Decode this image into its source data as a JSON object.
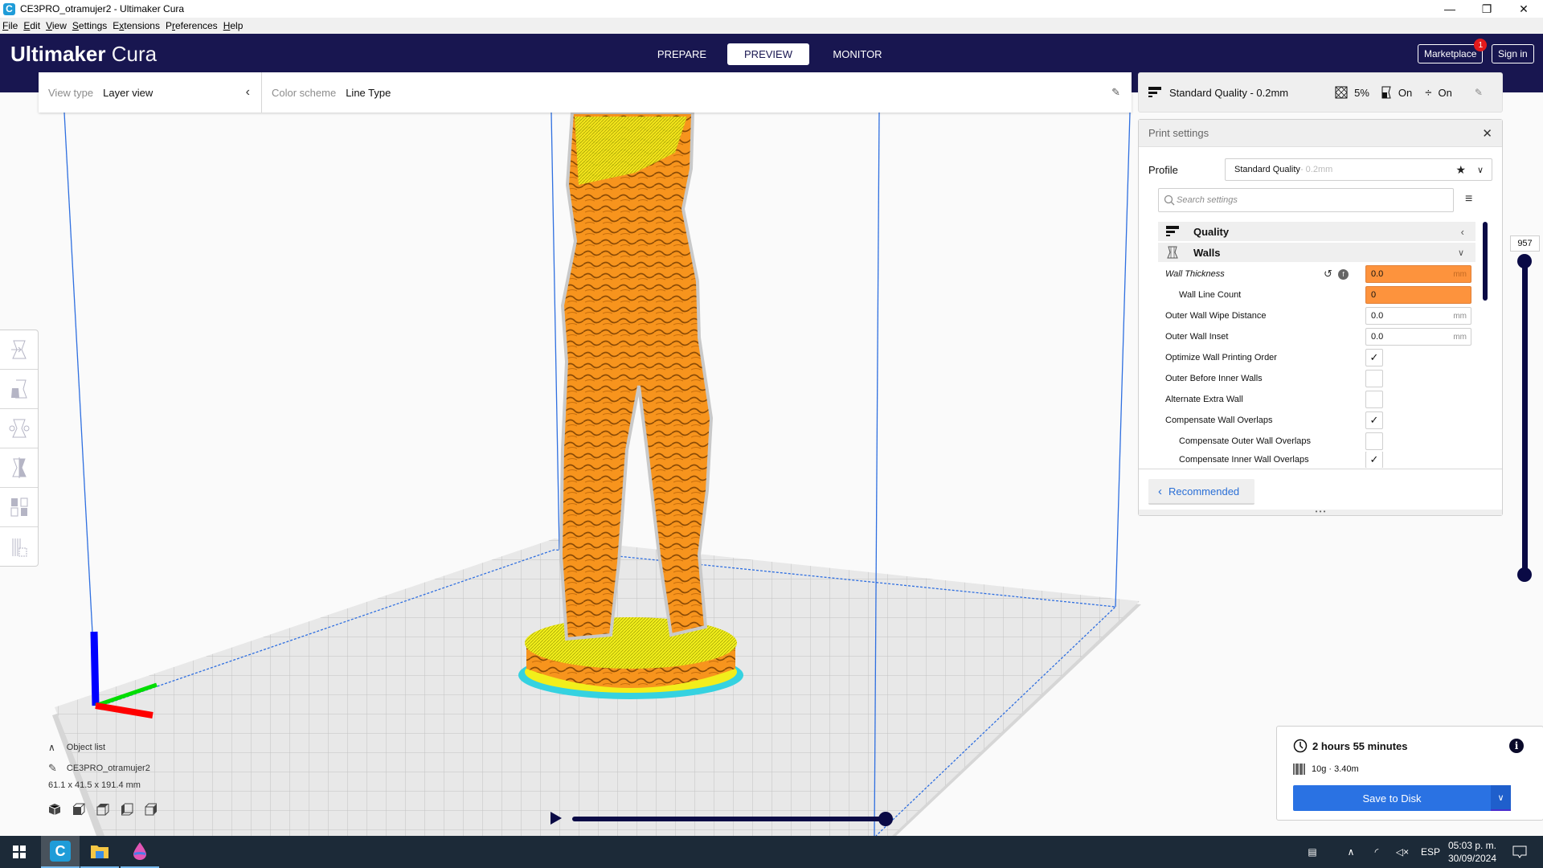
{
  "window": {
    "title": "CE3PRO_otramujer2 - Ultimaker Cura",
    "controls": {
      "minimize": "—",
      "maximize": "❐",
      "close": "✕"
    }
  },
  "menu": [
    {
      "label": "File",
      "accel": "F"
    },
    {
      "label": "Edit",
      "accel": "E"
    },
    {
      "label": "View",
      "accel": "V"
    },
    {
      "label": "Settings",
      "accel": "S"
    },
    {
      "label": "Extensions",
      "accel": "x"
    },
    {
      "label": "Preferences",
      "accel": "r"
    },
    {
      "label": "Help",
      "accel": "H"
    }
  ],
  "header": {
    "logo_bold": "Ultimaker",
    "logo_light": "Cura",
    "stages": [
      {
        "label": "PREPARE",
        "active": false
      },
      {
        "label": "PREVIEW",
        "active": true
      },
      {
        "label": "MONITOR",
        "active": false
      }
    ],
    "marketplace_label": "Marketplace",
    "marketplace_badge": "1",
    "signin_label": "Sign in"
  },
  "viewbar": {
    "view_type_label": "View type",
    "view_type_value": "Layer view",
    "color_scheme_label": "Color scheme",
    "color_scheme_value": "Line Type"
  },
  "setup_summary": {
    "profile": "Standard Quality - 0.2mm",
    "infill": "5%",
    "support": "On",
    "adhesion": "On"
  },
  "print_settings": {
    "title": "Print settings",
    "profile_label": "Profile",
    "profile_name": "Standard Quality",
    "profile_suffix": " - 0.2mm",
    "search_placeholder": "Search settings",
    "categories": [
      {
        "label": "Quality",
        "icon": "quality-icon",
        "expanded": false
      },
      {
        "label": "Walls",
        "icon": "walls-icon",
        "expanded": true
      }
    ],
    "settings": [
      {
        "label": "Wall Thickness",
        "type": "number",
        "value": "0.0",
        "unit": "mm",
        "highlight": true,
        "italic": true,
        "indent": 0
      },
      {
        "label": "Wall Line Count",
        "type": "number",
        "value": "0",
        "unit": "",
        "highlight": true,
        "italic": false,
        "indent": 1
      },
      {
        "label": "Outer Wall Wipe Distance",
        "type": "number",
        "value": "0.0",
        "unit": "mm",
        "highlight": false,
        "indent": 0
      },
      {
        "label": "Outer Wall Inset",
        "type": "number",
        "value": "0.0",
        "unit": "mm",
        "highlight": false,
        "indent": 0
      },
      {
        "label": "Optimize Wall Printing Order",
        "type": "check",
        "checked": true,
        "indent": 0
      },
      {
        "label": "Outer Before Inner Walls",
        "type": "check",
        "checked": false,
        "indent": 0
      },
      {
        "label": "Alternate Extra Wall",
        "type": "check",
        "checked": false,
        "indent": 0
      },
      {
        "label": "Compensate Wall Overlaps",
        "type": "check",
        "checked": true,
        "indent": 0
      },
      {
        "label": "Compensate Outer Wall Overlaps",
        "type": "check",
        "checked": false,
        "indent": 1
      },
      {
        "label": "Compensate Inner Wall Overlaps",
        "type": "check",
        "checked": true,
        "indent": 1
      }
    ],
    "recommended_label": "Recommended"
  },
  "layer_slider": {
    "current_layer": "957"
  },
  "object": {
    "list_label": "Object list",
    "name": "CE3PRO_otramujer2",
    "dimensions": "61.1 x 41.5 x 191.4 mm"
  },
  "output": {
    "print_time": "2 hours 55 minutes",
    "material": "10g · 3.40m",
    "save_label": "Save to Disk"
  },
  "taskbar": {
    "language": "ESP",
    "time": "05:03 p. m.",
    "date": "30/09/2024"
  },
  "colors": {
    "header_bg": "#181650",
    "accent_blue": "#2a72e3",
    "highlight_orange": "#fd933d",
    "model_orange": "#f7941d",
    "model_yellow": "#f2ee1b",
    "skirt_cyan": "#35d2e0"
  }
}
